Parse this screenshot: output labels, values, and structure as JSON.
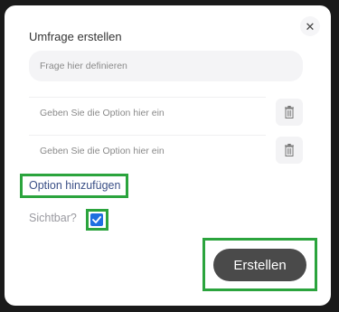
{
  "dialog": {
    "title": "Umfrage erstellen",
    "close_icon": "close-icon",
    "question_placeholder": "Frage hier definieren",
    "options": [
      {
        "placeholder": "Geben Sie die Option hier ein",
        "delete_icon": "trash-icon"
      },
      {
        "placeholder": "Geben Sie die Option hier ein",
        "delete_icon": "trash-icon"
      }
    ],
    "add_option_label": "Option hinzufügen",
    "visible_label": "Sichtbar?",
    "visible_checked": true,
    "create_label": "Erstellen"
  },
  "colors": {
    "highlight": "#2ba43d",
    "checkbox": "#1f6fe0",
    "link": "#3a4f86",
    "button": "#4a4a4a"
  }
}
